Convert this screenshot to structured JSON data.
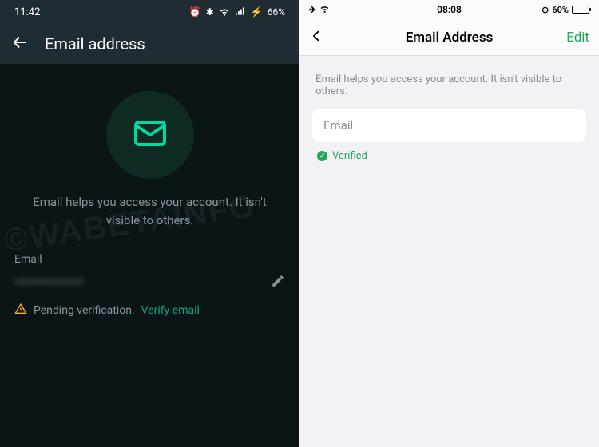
{
  "left": {
    "status_time": "11:42",
    "status_battery": "66%",
    "header_title": "Email address",
    "description": "Email helps you access your account. It isn't visible to others.",
    "email_label": "Email",
    "email_value_obscured": "••••••••••••••",
    "pending_text": "Pending verification.",
    "verify_link": "Verify email"
  },
  "right": {
    "status_time": "08:08",
    "status_battery": "60%",
    "header_title": "Email Address",
    "edit_label": "Edit",
    "description": "Email helps you access your account. It isn't visible to others.",
    "email_label": "Email",
    "verified_label": "Verified"
  },
  "watermark": "©WABETAINFO"
}
